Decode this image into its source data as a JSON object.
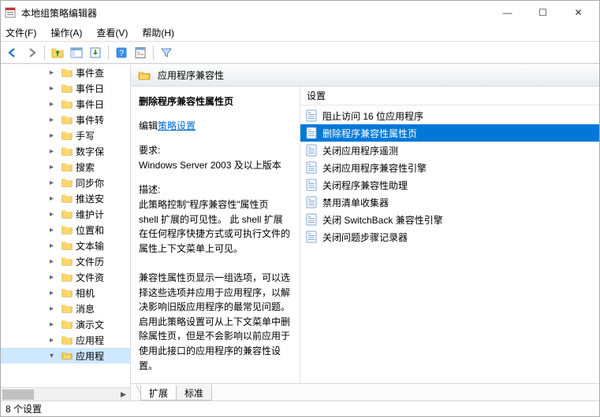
{
  "window": {
    "title": "本地组策略编辑器"
  },
  "title_btns": {
    "min": "—",
    "max": "☐",
    "close": "✕"
  },
  "menu": {
    "file": "文件(F)",
    "action": "操作(A)",
    "view": "查看(V)",
    "help": "帮助(H)"
  },
  "toolbar_icons": {
    "back": "back-icon",
    "fwd": "forward-icon",
    "up": "up-icon",
    "show": "show-pane-icon",
    "export": "export-icon",
    "help": "help-icon",
    "props": "properties-icon",
    "filter": "filter-icon"
  },
  "tree": {
    "items": [
      {
        "label": "事件查"
      },
      {
        "label": "事件日"
      },
      {
        "label": "事件日"
      },
      {
        "label": "事件转"
      },
      {
        "label": "手写"
      },
      {
        "label": "数字保"
      },
      {
        "label": "搜索"
      },
      {
        "label": "同步你"
      },
      {
        "label": "推送安"
      },
      {
        "label": "维护计"
      },
      {
        "label": "位置和"
      },
      {
        "label": "文本输"
      },
      {
        "label": "文件历"
      },
      {
        "label": "文件资"
      },
      {
        "label": "相机"
      },
      {
        "label": "消息"
      },
      {
        "label": "演示文"
      },
      {
        "label": "应用程"
      },
      {
        "label": "应用程",
        "selected": true,
        "expanded": true
      }
    ]
  },
  "header": {
    "title": "应用程序兼容性"
  },
  "detail": {
    "title": "删除程序兼容性属性页",
    "edit_prefix": "编辑",
    "edit_link": "策略设置",
    "req_label": "要求:",
    "req_value": "Windows Server 2003 及以上版本",
    "desc_label": "描述:",
    "desc_body": "此策略控制\"程序兼容性\"属性页 shell 扩展的可见性。 此 shell 扩展在任何程序快捷方式或可执行文件的属性上下文菜单上可见。\n\n兼容性属性页显示一组选项，可以选择这些选项并应用于应用程序，以解决影响旧版应用程序的最常见问题。启用此策略设置可从上下文菜单中删除属性页，但是不会影响以前应用于使用此接口的应用程序的兼容性设置。"
  },
  "list": {
    "header": "设置",
    "rows": [
      {
        "label": "阻止访问 16 位应用程序"
      },
      {
        "label": "删除程序兼容性属性页",
        "selected": true
      },
      {
        "label": "关闭应用程序遥测"
      },
      {
        "label": "关闭应用程序兼容性引擎"
      },
      {
        "label": "关闭程序兼容性助理"
      },
      {
        "label": "禁用清单收集器"
      },
      {
        "label": "关闭 SwitchBack 兼容性引擎"
      },
      {
        "label": "关闭问题步骤记录器"
      }
    ]
  },
  "tabs": {
    "extended": "扩展",
    "standard": "标准"
  },
  "status": {
    "text": "8 个设置"
  }
}
